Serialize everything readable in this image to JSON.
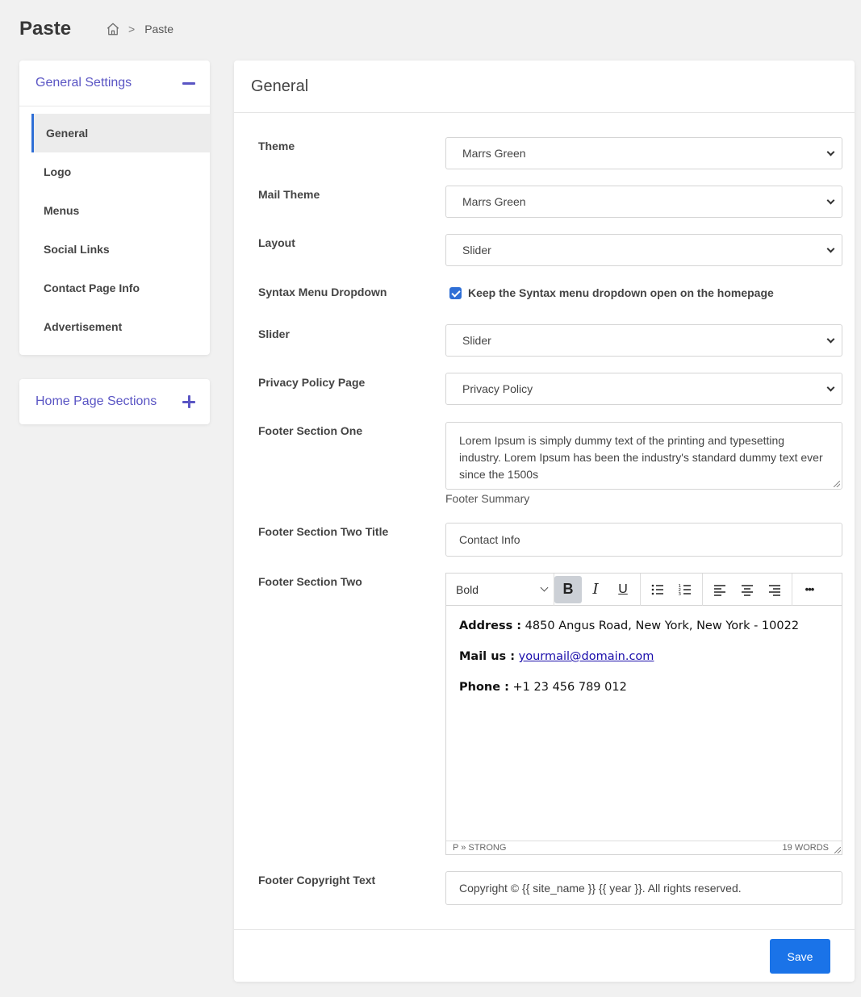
{
  "page": {
    "title": "Paste"
  },
  "breadcrumb": {
    "home_icon": "home-icon",
    "separator": ">",
    "current": "Paste"
  },
  "sidebar": {
    "general_settings": {
      "title": "General Settings",
      "items": [
        {
          "label": "General",
          "active": true
        },
        {
          "label": "Logo"
        },
        {
          "label": "Menus"
        },
        {
          "label": "Social Links"
        },
        {
          "label": "Contact Page Info"
        },
        {
          "label": "Advertisement"
        }
      ]
    },
    "home_sections": {
      "title": "Home Page Sections"
    }
  },
  "main": {
    "title": "General",
    "fields": {
      "theme": {
        "label": "Theme",
        "value": "Marrs Green"
      },
      "mail_theme": {
        "label": "Mail Theme",
        "value": "Marrs Green"
      },
      "layout": {
        "label": "Layout",
        "value": "Slider"
      },
      "syntax_menu": {
        "label": "Syntax Menu Dropdown",
        "checkbox_label": "Keep the Syntax menu dropdown open on the homepage",
        "checked": true
      },
      "slider": {
        "label": "Slider",
        "value": "Slider"
      },
      "privacy": {
        "label": "Privacy Policy Page",
        "value": "Privacy Policy"
      },
      "footer_one": {
        "label": "Footer Section One",
        "value": "Lorem Ipsum is simply dummy text of the printing and typesetting industry. Lorem Ipsum has been the industry's standard dummy text ever since the 1500s",
        "help": "Footer Summary"
      },
      "footer_two_title": {
        "label": "Footer Section Two Title",
        "value": "Contact Info"
      },
      "footer_two": {
        "label": "Footer Section Two",
        "toolbar": {
          "block_format": "Bold",
          "bold": "B",
          "italic": "I",
          "underline": "U",
          "more": "•••"
        },
        "content": {
          "address_label": "Address :",
          "address_value": " 4850 Angus Road, New York, New York - 10022",
          "mail_label": "Mail us :",
          "mail_value": "yourmail@domain.com",
          "phone_label": "Phone :",
          "phone_value": " +1 23 456 789 012"
        },
        "status_path": "P » STRONG",
        "word_count": "19 WORDS"
      },
      "copyright": {
        "label": "Footer Copyright Text",
        "value": "Copyright © {{ site_name }} {{ year }}. All rights reserved."
      }
    },
    "save_label": "Save"
  },
  "colors": {
    "accent": "#5a55c4",
    "primary": "#1a73e8",
    "active_border": "#2f6fd6"
  }
}
